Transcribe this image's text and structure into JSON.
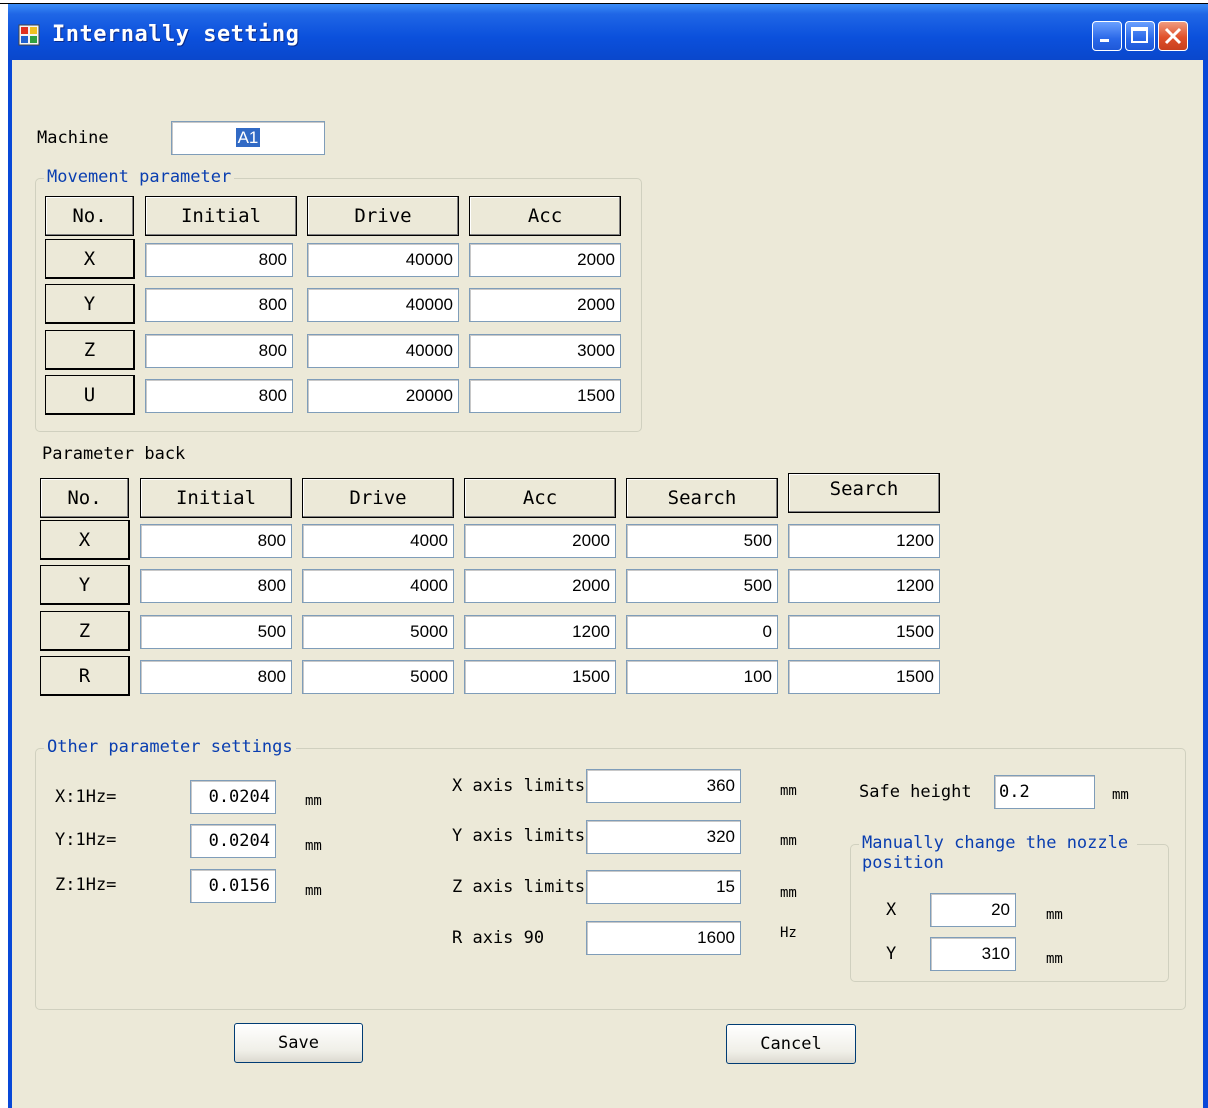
{
  "window": {
    "title": "Internally setting",
    "colors": {
      "titlebar": "#0a50dc",
      "client": "#ece9d8",
      "group_label": "#0a3eb0"
    },
    "controls": {
      "minimize_icon": "minimize-icon",
      "maximize_icon": "maximize-icon",
      "close_icon": "close-icon"
    }
  },
  "machine": {
    "label": "Machine",
    "value": "A1"
  },
  "movement": {
    "title": "Movement parameter",
    "headers": [
      "No.",
      "Initial",
      "Drive",
      "Acc"
    ],
    "rows": [
      {
        "axis": "X",
        "values": [
          "800",
          "40000",
          "2000"
        ]
      },
      {
        "axis": "Y",
        "values": [
          "800",
          "40000",
          "2000"
        ]
      },
      {
        "axis": "Z",
        "values": [
          "800",
          "40000",
          "3000"
        ]
      },
      {
        "axis": "U",
        "values": [
          "800",
          "20000",
          "1500"
        ]
      }
    ]
  },
  "back": {
    "title": "Parameter back",
    "headers": [
      "No.",
      "Initial",
      "Drive",
      "Acc",
      "Search",
      "Search"
    ],
    "rows": [
      {
        "axis": "X",
        "values": [
          "800",
          "4000",
          "2000",
          "500",
          "1200"
        ]
      },
      {
        "axis": "Y",
        "values": [
          "800",
          "4000",
          "2000",
          "500",
          "1200"
        ]
      },
      {
        "axis": "Z",
        "values": [
          "500",
          "5000",
          "1200",
          "0",
          "1500"
        ]
      },
      {
        "axis": "R",
        "values": [
          "800",
          "5000",
          "1500",
          "100",
          "1500"
        ]
      }
    ]
  },
  "other": {
    "title": "Other parameter settings",
    "hz": [
      {
        "label": "X:1Hz=",
        "value": "0.0204",
        "unit": "mm"
      },
      {
        "label": "Y:1Hz=",
        "value": "0.0204",
        "unit": "mm"
      },
      {
        "label": "Z:1Hz=",
        "value": "0.0156",
        "unit": "mm"
      }
    ],
    "limits": [
      {
        "label": "X axis limits",
        "value": "360",
        "unit": "mm"
      },
      {
        "label": "Y axis limits",
        "value": "320",
        "unit": "mm"
      },
      {
        "label": "Z axis limits",
        "value": "15",
        "unit": "mm"
      },
      {
        "label": "R axis 90",
        "value": "1600",
        "unit": "Hz"
      }
    ],
    "safe_height": {
      "label": "Safe height",
      "value": "0.2",
      "unit": "mm"
    },
    "nozzle": {
      "title": "Manually change the nozzle position",
      "x": {
        "label": "X",
        "value": "20",
        "unit": "mm"
      },
      "y": {
        "label": "Y",
        "value": "310",
        "unit": "mm"
      }
    }
  },
  "buttons": {
    "save": "Save",
    "cancel": "Cancel"
  }
}
